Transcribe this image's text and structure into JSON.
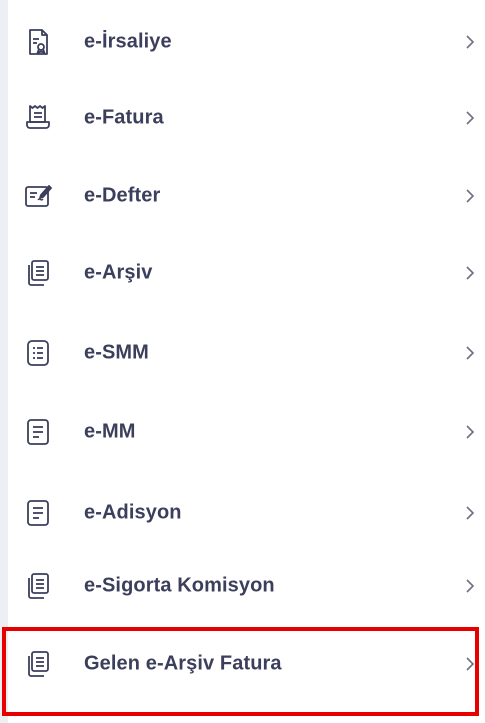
{
  "menu": {
    "items": [
      {
        "label": "e-İrsaliye",
        "icon": "waybill-document-icon"
      },
      {
        "label": "e-Fatura",
        "icon": "invoice-receipt-icon"
      },
      {
        "label": "e-Defter",
        "icon": "ledger-sign-icon"
      },
      {
        "label": "e-Arşiv",
        "icon": "archive-documents-icon"
      },
      {
        "label": "e-SMM",
        "icon": "smm-list-document-icon"
      },
      {
        "label": "e-MM",
        "icon": "mm-document-icon"
      },
      {
        "label": "e-Adisyon",
        "icon": "adisyon-document-icon"
      },
      {
        "label": "e-Sigorta Komisyon",
        "icon": "insurance-documents-icon"
      },
      {
        "label": "Gelen e-Arşiv Fatura",
        "icon": "incoming-archive-documents-icon"
      }
    ],
    "chevron_icon": "chevron-right-icon",
    "highlighted_item": "Gelen e-Arşiv Fatura"
  },
  "colors": {
    "text": "#3b3f5c",
    "icon": "#3b3f5c",
    "chevron": "#6b6f80",
    "highlight_border": "#e60000",
    "background": "#ffffff"
  }
}
